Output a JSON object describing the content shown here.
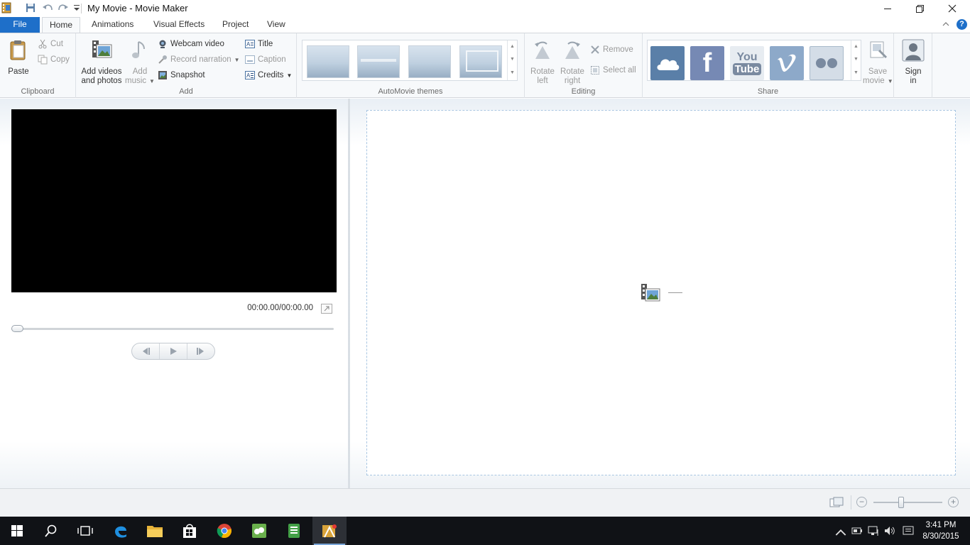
{
  "window": {
    "title": "My Movie - Movie Maker",
    "controls": [
      "minimize",
      "maximize",
      "close"
    ]
  },
  "tabs": [
    {
      "label": "File",
      "active": false
    },
    {
      "label": "Home",
      "active": true
    },
    {
      "label": "Animations",
      "active": false
    },
    {
      "label": "Visual Effects",
      "active": false
    },
    {
      "label": "Project",
      "active": false
    },
    {
      "label": "View",
      "active": false
    }
  ],
  "ribbon": {
    "clipboard": {
      "label": "Clipboard",
      "paste": "Paste",
      "cut": "Cut",
      "copy": "Copy"
    },
    "add": {
      "label": "Add",
      "add_videos_line1": "Add videos",
      "add_videos_line2": "and photos",
      "add_music_line1": "Add",
      "add_music_line2": "music",
      "webcam": "Webcam video",
      "record_narration": "Record narration",
      "snapshot": "Snapshot",
      "title": "Title",
      "caption": "Caption",
      "credits": "Credits"
    },
    "themes": {
      "label": "AutoMovie themes",
      "count": 4
    },
    "editing": {
      "label": "Editing",
      "rotate_left_line1": "Rotate",
      "rotate_left_line2": "left",
      "rotate_right_line1": "Rotate",
      "rotate_right_line2": "right",
      "remove": "Remove",
      "select_all": "Select all"
    },
    "share": {
      "label": "Share",
      "services": [
        "OneDrive",
        "Facebook",
        "YouTube",
        "Vimeo",
        "Flickr"
      ],
      "youtube_line1": "You",
      "youtube_line2": "Tube",
      "facebook_glyph": "f",
      "save_movie_line1": "Save",
      "save_movie_line2": "movie"
    },
    "signin": {
      "line1": "Sign",
      "line2": "in"
    }
  },
  "preview": {
    "timecode": "00:00.00/00:00.00",
    "seek_position": 0
  },
  "storyboard": {
    "empty": true
  },
  "statusbar": {
    "zoom_level": 0.4
  },
  "taskbar": {
    "apps": [
      "Start",
      "Search",
      "Task View",
      "Microsoft Edge",
      "File Explorer",
      "Store",
      "Google Chrome",
      "Green app",
      "Notepad",
      "Movie Maker"
    ],
    "time": "3:41 PM",
    "date": "8/30/2015"
  },
  "colors": {
    "file_tab": "#1e6fc9",
    "storyboard_border": "#a9c6e2",
    "taskbar": "#101216"
  }
}
